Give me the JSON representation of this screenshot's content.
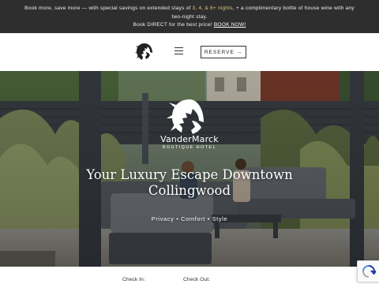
{
  "promo": {
    "line1_a": "Book more, save more — with special savings on extended stays of",
    "line1_nights": "3, 4, & 6+ nights",
    "line1_b": ", + a complimentary bottle of house wine with any",
    "line2": "two-night stay.",
    "line3_text": "Book DIRECT for the best price!",
    "line3_link": "BOOK NOW!"
  },
  "header": {
    "logo_icon": "lion-head-icon",
    "menu_icon": "hamburger-menu-icon",
    "reserve_label": "RESERVE →"
  },
  "hero": {
    "brand_name": "VanderMarck",
    "brand_tagline": "BOUTIQUE HOTEL",
    "title_line1": "Your Luxury Escape Downtown",
    "title_line2": "Collingwood",
    "subtitle": "Privacy • Comfort • Style"
  },
  "booking": {
    "check_in_label": "Check In:",
    "check_out_label": "Check Out:"
  },
  "colors": {
    "promo_bg": "#2e2e2e",
    "promo_highlight": "#d9c37e"
  }
}
